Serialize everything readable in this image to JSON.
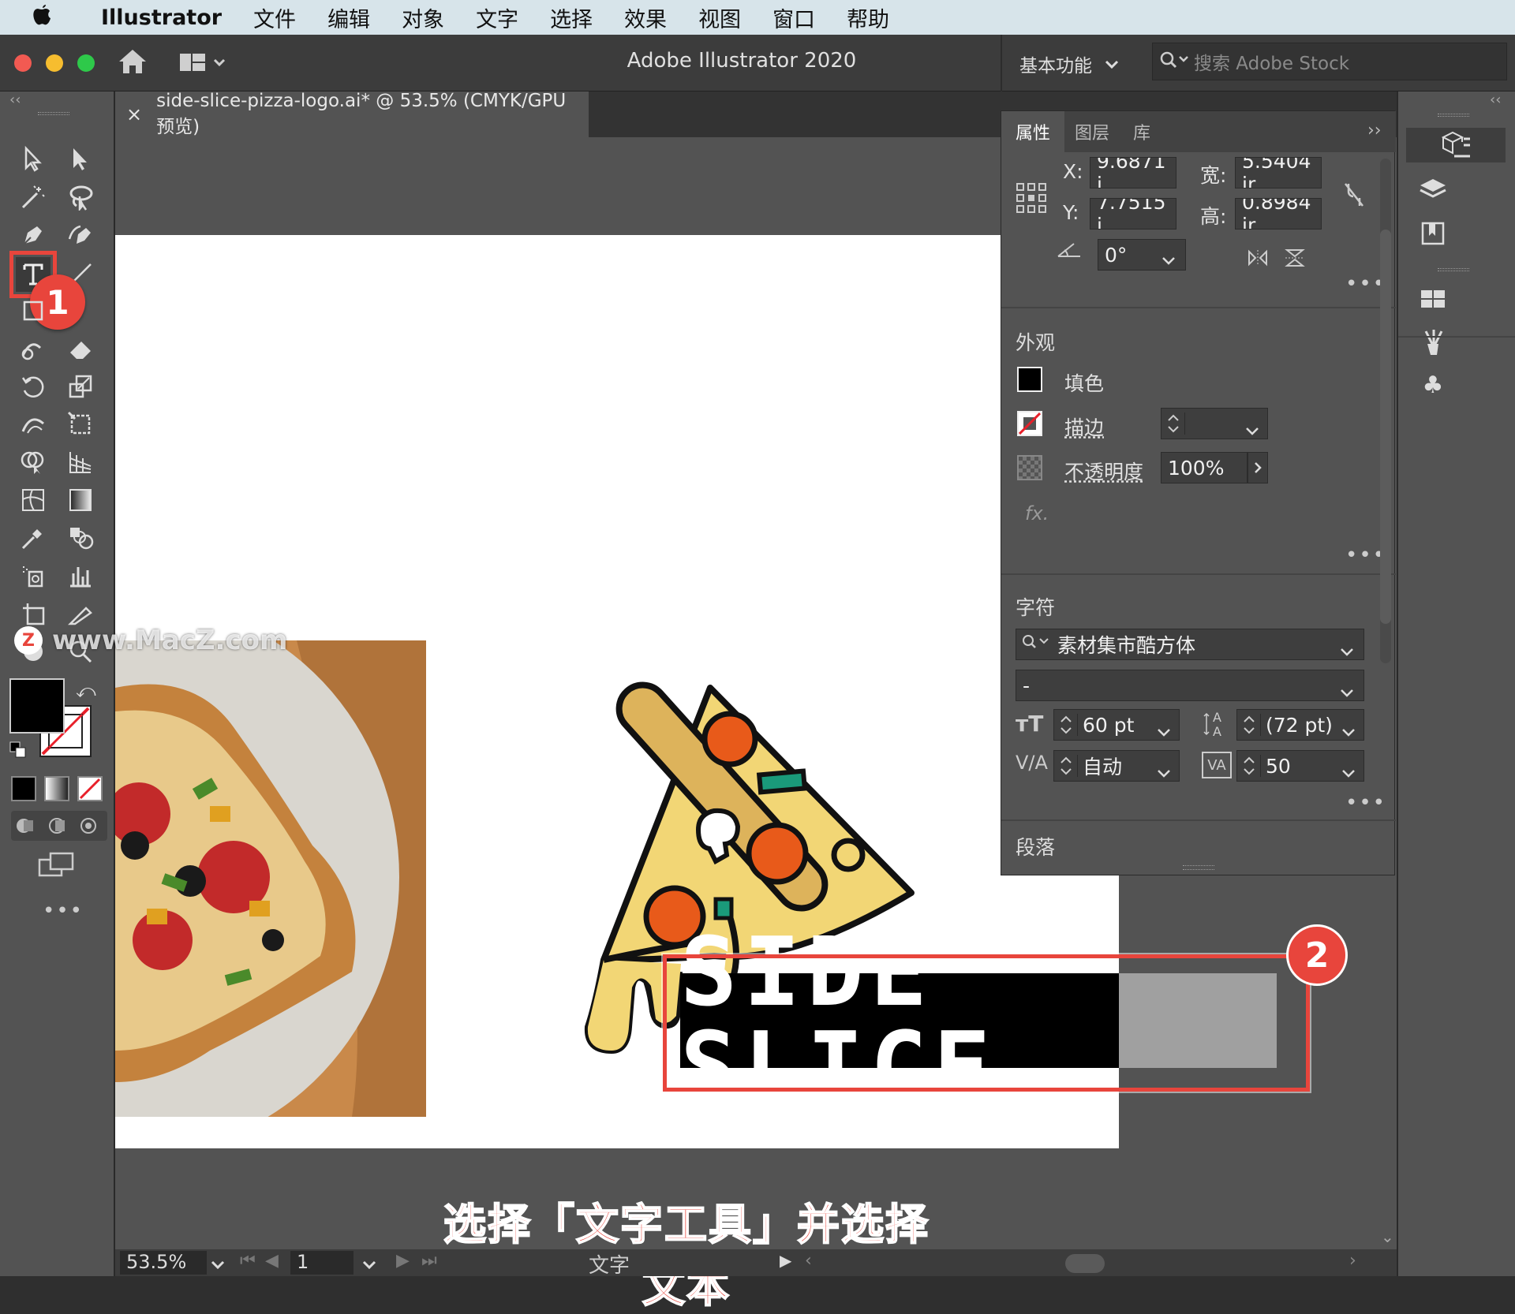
{
  "menubar": {
    "apple": "",
    "app": "Illustrator",
    "items": [
      "文件",
      "编辑",
      "对象",
      "文字",
      "选择",
      "效果",
      "视图",
      "窗口",
      "帮助"
    ]
  },
  "titlebar": {
    "title": "Adobe Illustrator 2020",
    "workspace": "基本功能",
    "search_placeholder": "搜索 Adobe Stock"
  },
  "document_tab": {
    "close": "×",
    "title": "side-slice-pizza-logo.ai* @ 53.5% (CMYK/GPU 预览)"
  },
  "properties_panel": {
    "tabs": [
      "属性",
      "图层",
      "库"
    ],
    "transform": {
      "x_label": "X:",
      "x_value": "9.6871 i",
      "y_label": "Y:",
      "y_value": "7.7515 i",
      "w_label": "宽:",
      "w_value": "5.5404 ir",
      "h_label": "高:",
      "h_value": "0.8984 ir",
      "angle_value": "0°"
    },
    "appearance": {
      "title": "外观",
      "fill_label": "填色",
      "stroke_label": "描边",
      "opacity_label": "不透明度",
      "opacity_value": "100%",
      "fx_label": "fx."
    },
    "character": {
      "title": "字符",
      "font_family": "素材集市酷方体",
      "font_style": "-",
      "font_size": "60 pt",
      "leading": "(72 pt)",
      "kerning": "自动",
      "tracking": "50"
    },
    "paragraph": {
      "title": "段落"
    }
  },
  "annotations": {
    "step1": "1",
    "step2": "2",
    "caption": "选择「文字工具」并选择文本",
    "watermark": "www.MacZ.com"
  },
  "artwork": {
    "logo_text": "SIDE SLICE"
  },
  "statusbar": {
    "zoom": "53.5%",
    "artboard": "1",
    "tool_name": "文字"
  },
  "colors": {
    "accent_red": "#e8453c",
    "crust": "#ddb35b",
    "cheese": "#f2d675",
    "pepperoni": "#e85a1a",
    "green": "#1a9a7a"
  }
}
